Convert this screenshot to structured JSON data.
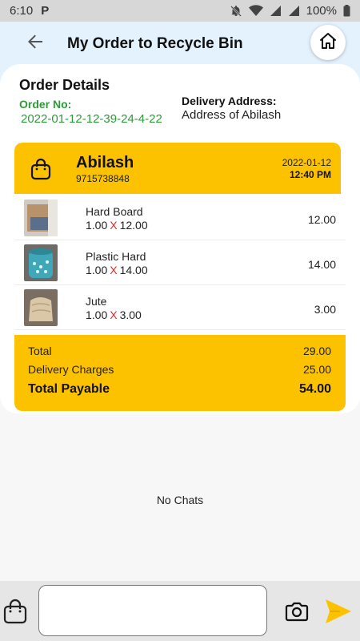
{
  "status_bar": {
    "time": "6:10",
    "app_icon": "P",
    "battery": "100%"
  },
  "app_bar": {
    "title": "My Order to Recycle Bin"
  },
  "order_details": {
    "title": "Order Details",
    "order_no_label": "Order No:",
    "order_no": "2022-01-12-12-39-24-4-22",
    "address_label": "Delivery Address:",
    "address": "Address of Abilash"
  },
  "order_card": {
    "customer_name": "Abilash",
    "phone": "9715738848",
    "date": "2022-01-12",
    "time": "12:40 PM",
    "items": [
      {
        "name": "Hard Board",
        "qty": "1.00",
        "x": "X",
        "rate": "12.00",
        "amount": "12.00"
      },
      {
        "name": "Plastic Hard",
        "qty": "1.00",
        "x": "X",
        "rate": "14.00",
        "amount": "14.00"
      },
      {
        "name": "Jute",
        "qty": "1.00",
        "x": "X",
        "rate": "3.00",
        "amount": "3.00"
      }
    ],
    "totals": {
      "total_label": "Total",
      "total": "29.00",
      "delivery_label": "Delivery Charges",
      "delivery": "25.00",
      "payable_label": "Total Payable",
      "payable": "54.00"
    }
  },
  "chat": {
    "empty_text": "No Chats",
    "input_value": ""
  },
  "colors": {
    "accent": "#fcc200",
    "green": "#2e9a3a",
    "header_bg": "#e3f2fd",
    "multiply": "#e12b2b"
  },
  "icons": [
    "back-arrow-icon",
    "home-icon",
    "shopping-bag-icon",
    "camera-icon",
    "send-icon"
  ]
}
